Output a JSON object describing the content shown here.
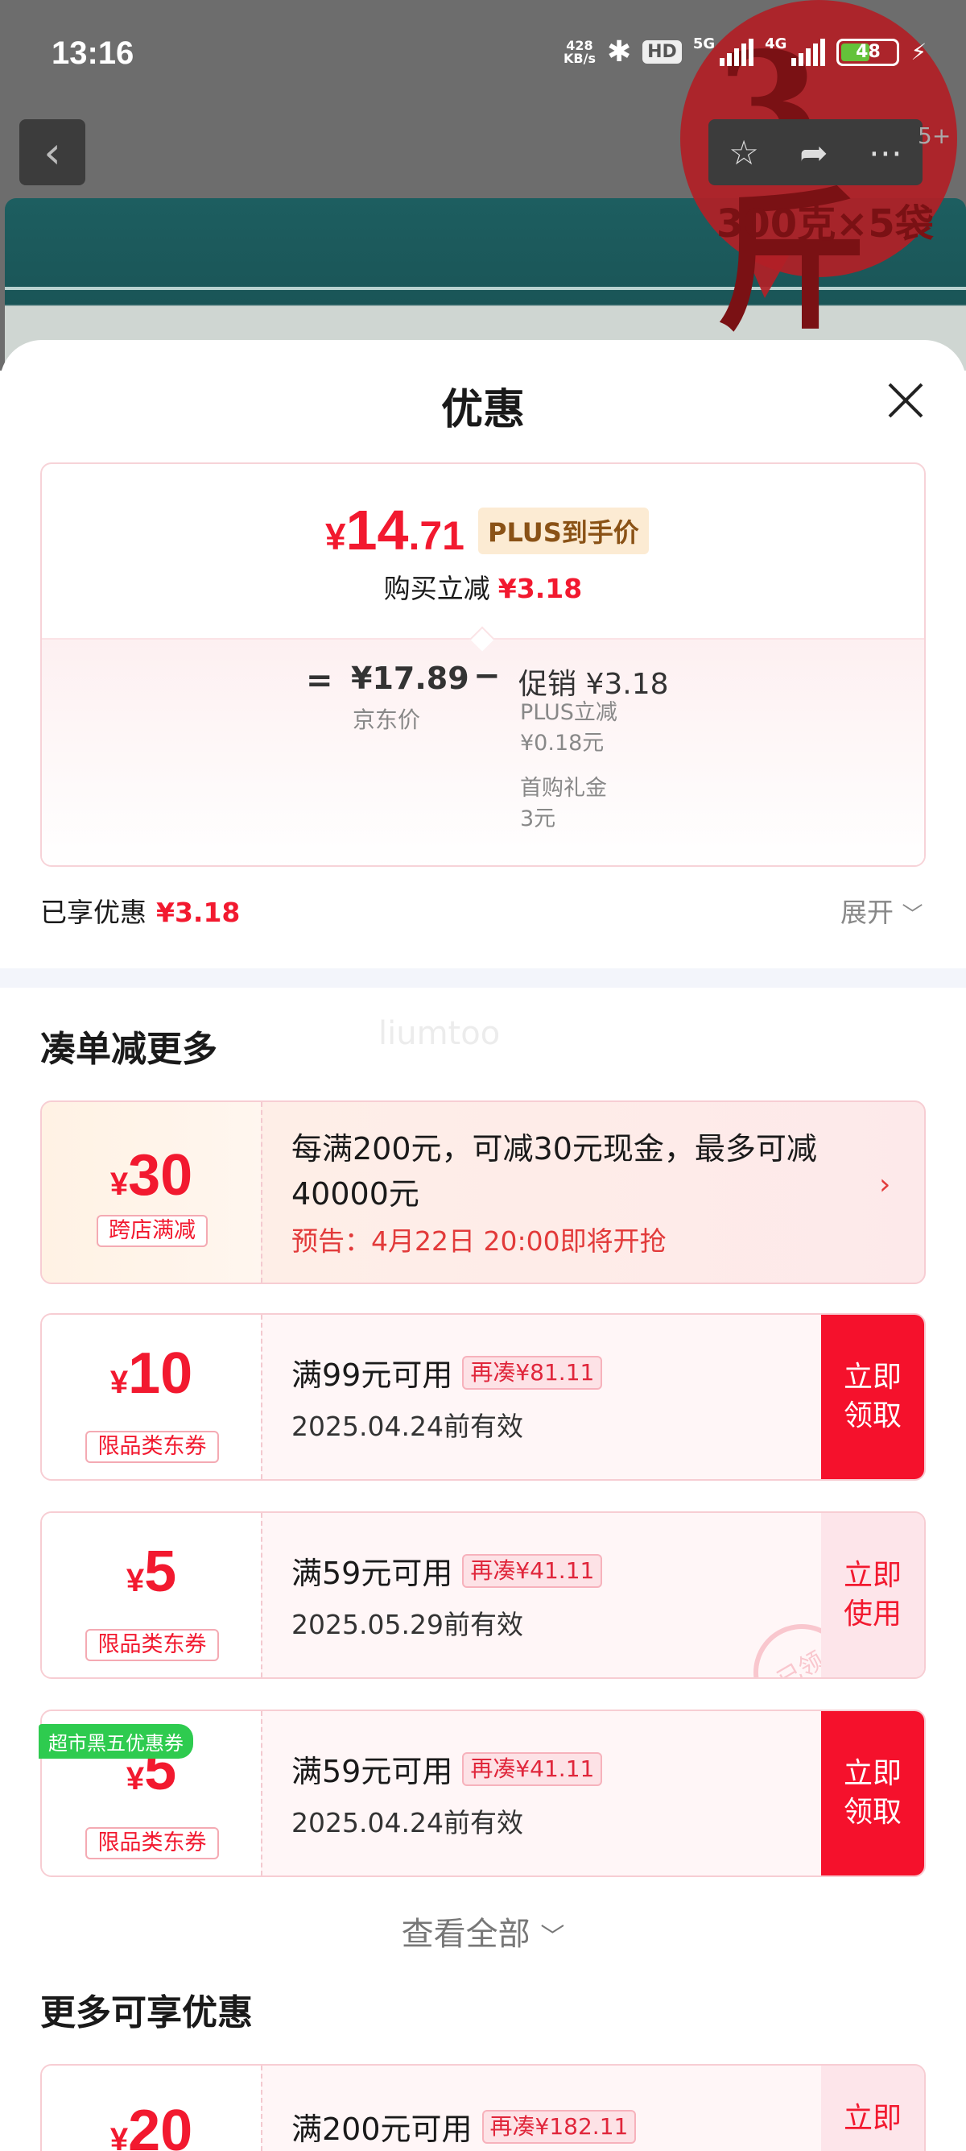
{
  "status_bar": {
    "time": "13:16",
    "net_speed_value": "428",
    "net_speed_unit": "KB/s",
    "hd": "HD",
    "sig1_label": "5G",
    "sig2_label": "4G",
    "battery": "48"
  },
  "background": {
    "promo_big": "3斤",
    "promo_sub": "300克×5袋",
    "badge_count": "5+"
  },
  "sheet": {
    "title": "优惠",
    "price_card": {
      "yen": "¥",
      "final_int": "14",
      "final_dec": ".71",
      "plus_tag": "PLUS到手价",
      "reduce_label": "购买立减",
      "reduce_value": "¥3.18",
      "eq": "=",
      "jd_price": "¥17.89",
      "jd_label": "京东价",
      "minus": "−",
      "promo_head": "促销 ¥3.18",
      "promo_details": [
        "PLUS立减",
        "¥0.18元",
        "首购礼金",
        "3元"
      ]
    },
    "enjoyed_label": "已享优惠",
    "enjoyed_value": "¥3.18",
    "expand_label": "展开",
    "section1_title": "凑单减更多",
    "watermark": "liumtoo",
    "coupons": [
      {
        "yen": "¥",
        "amount": "30",
        "kind": "跨店满减",
        "main": "每满200元，可减30元现金，最多可减40000元",
        "note": "预告：4月22日 20:00即将开抢"
      },
      {
        "yen": "¥",
        "amount": "10",
        "kind": "限品类东券",
        "cond": "满99元可用",
        "more": "再凑¥81.11",
        "valid": "2025.04.24前有效",
        "btn_line1": "立即",
        "btn_line2": "领取"
      },
      {
        "yen": "¥",
        "amount": "5",
        "kind": "限品类东券",
        "cond": "满59元可用",
        "more": "再凑¥41.11",
        "valid": "2025.05.29前有效",
        "btn_line1": "立即",
        "btn_line2": "使用",
        "stamp": "已领"
      },
      {
        "yen": "¥",
        "amount": "5",
        "kind": "限品类东券",
        "cond": "满59元可用",
        "more": "再凑¥41.11",
        "valid": "2025.04.24前有效",
        "btn_line1": "立即",
        "btn_line2": "领取"
      }
    ],
    "view_all": "查看全部",
    "section2_title": "更多可享优惠",
    "more_coupon": {
      "tag": "超市黑五优惠券",
      "yen": "¥",
      "amount": "20",
      "cond": "满200元可用",
      "more": "再凑¥182.11",
      "btn_line1": "立即"
    }
  },
  "colors": {
    "accent_red": "#f2192f",
    "button_red": "#f5112c",
    "tag_green": "#2ecb4f",
    "plus_gold": "#8a5216"
  }
}
